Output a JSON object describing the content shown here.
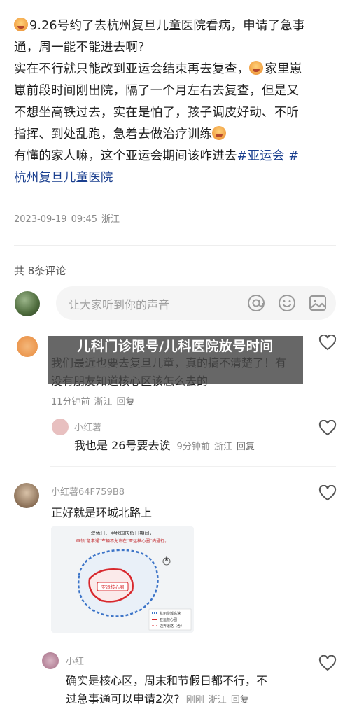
{
  "post": {
    "lines": [
      "9.26号约了去杭州复旦儿童医院看病，申请了急事",
      "通，周一能不能进去啊?",
      "实在不行就只能改到亚运会结束再去复查，",
      "家里崽",
      "崽前段时间刚出院，隔了一个月左右去复查，但是又",
      "不想坐高铁过去，实在是怕了，孩子调皮好动、不听",
      "指挥、到处乱跑，急着去做治疗训练",
      "有懂的家人嘛，这个亚运会期间该咋进去",
      "#亚运会 #",
      "杭州复旦儿童医院"
    ],
    "date": "2023-09-19",
    "time": "09:45",
    "location": "浙江"
  },
  "comments_header": {
    "count_label": "共 8条评论"
  },
  "comment_input": {
    "placeholder": "让大家听到你的声音",
    "icons": [
      "at-icon",
      "emoji-icon",
      "image-icon"
    ]
  },
  "overlay": {
    "title": "儿科门诊限号/儿科医院放号时间"
  },
  "comments": [
    {
      "text": "我们最近也要去复旦儿童，真的搞不清楚了！有没有朋友知道核心区该怎么去的",
      "time": "11分钟前",
      "location": "浙江",
      "reply_label": "回复"
    },
    {
      "name": "小红薯",
      "text": "我也是 26号要去诶",
      "time": "9分钟前",
      "location": "浙江",
      "reply_label": "回复"
    },
    {
      "name": "小红薯64F759B8",
      "text": "正好就是环城北路上",
      "map": {
        "header_line1": "双休日、甲秋国庆假日期间，",
        "header_line2": "申领“急事通”车辆不允许在“亚运核心圈”内通行。",
        "ring_label": "亚运核心圈",
        "legend": [
          "杭州绕城高速",
          "亚运核心圈",
          "边界道路（含）"
        ]
      }
    },
    {
      "name": "小红",
      "text_line1": "确实是核心区，周末和节假日都不行，不",
      "text_line2": "过急事通可以申请2次?",
      "time": "刚刚",
      "location": "浙江",
      "reply_label": "回复"
    }
  ],
  "colors": {
    "tag": "#1a3f8f",
    "muted": "#8a8a8a",
    "overlay_bg": "#464646"
  }
}
